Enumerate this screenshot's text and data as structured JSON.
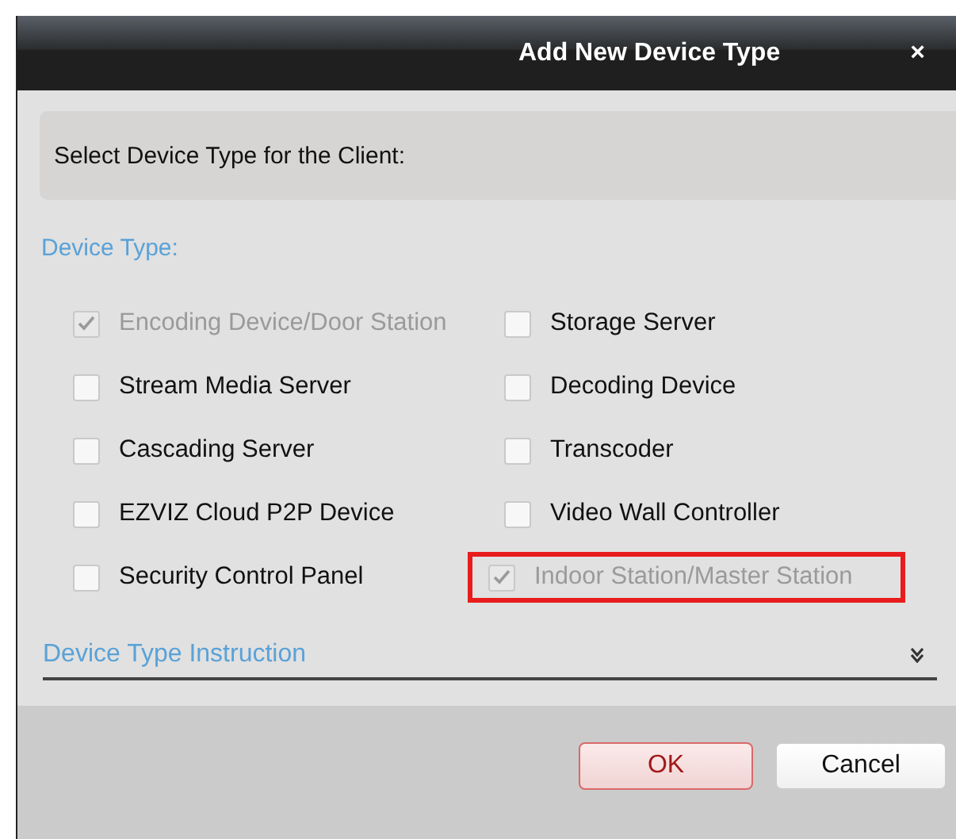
{
  "window": {
    "title": "Add New Device Type",
    "close": "×"
  },
  "header": {
    "text": "Select Device Type for the Client:"
  },
  "section_label": "Device Type:",
  "device_types": [
    {
      "label": "Encoding Device/Door Station",
      "checked": true,
      "disabled": true,
      "highlighted": false
    },
    {
      "label": "Storage Server",
      "checked": false,
      "disabled": false,
      "highlighted": false
    },
    {
      "label": "Stream Media Server",
      "checked": false,
      "disabled": false,
      "highlighted": false
    },
    {
      "label": "Decoding Device",
      "checked": false,
      "disabled": false,
      "highlighted": false
    },
    {
      "label": "Cascading Server",
      "checked": false,
      "disabled": false,
      "highlighted": false
    },
    {
      "label": "Transcoder",
      "checked": false,
      "disabled": false,
      "highlighted": false
    },
    {
      "label": "EZVIZ Cloud P2P Device",
      "checked": false,
      "disabled": false,
      "highlighted": false
    },
    {
      "label": "Video Wall Controller",
      "checked": false,
      "disabled": false,
      "highlighted": false
    },
    {
      "label": "Security Control Panel",
      "checked": false,
      "disabled": false,
      "highlighted": false
    },
    {
      "label": "Indoor Station/Master Station",
      "checked": true,
      "disabled": true,
      "highlighted": true
    }
  ],
  "instruction": {
    "label": "Device Type Instruction",
    "expanded": false
  },
  "buttons": [
    {
      "label": "OK",
      "kind": "primary"
    },
    {
      "label": "Cancel",
      "kind": "secondary"
    }
  ]
}
